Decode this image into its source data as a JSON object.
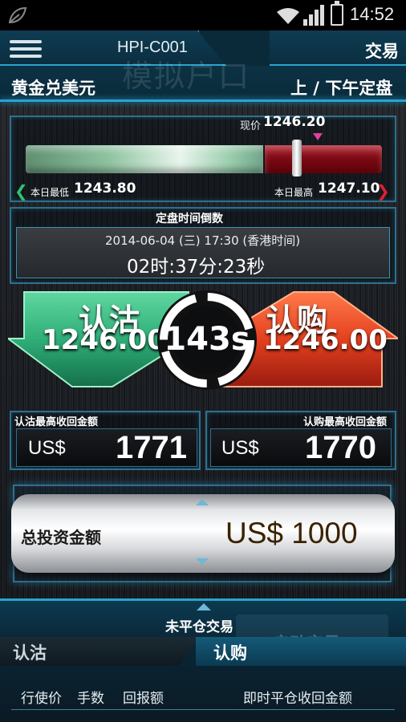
{
  "status_bar": {
    "time": "14:52",
    "icons": [
      "leaf-icon",
      "wifi-icon",
      "signal-icon",
      "battery-charging-icon"
    ]
  },
  "header": {
    "account": "HPI-C001",
    "trade_tab": "交易",
    "watermark": "模拟户口",
    "product": "黄金兑美元",
    "session": "上 / 下午定盘"
  },
  "price": {
    "now_label": "现价",
    "now_value": "1246.20",
    "low_label": "本日最低",
    "low_value": "1243.80",
    "high_label": "本日最高",
    "high_value": "1247.10",
    "now_position": 0.82
  },
  "countdown": {
    "title": "定盘时间倒数",
    "date_line": "2014-06-04 (三) 17:30 (香港时间)",
    "remaining": "02时:37分:23秒"
  },
  "trade": {
    "put_label": "认沽",
    "put_price": "1246.00",
    "call_label": "认购",
    "call_price": "1246.00",
    "dial": "143s",
    "colors": {
      "put": "#2fae78",
      "call": "#e4401f"
    }
  },
  "payout": {
    "put_title": "认沽最高收回金额",
    "put_currency": "US$",
    "put_value": "1771",
    "call_title": "认购最高收回金额",
    "call_currency": "US$",
    "call_value": "1770"
  },
  "investment": {
    "label": "总投资金额",
    "value": "US$ 1000"
  },
  "positions": {
    "title": "未平仓交易",
    "start_button": "启动交易",
    "tab_put": "认沽",
    "tab_call": "认购",
    "columns": [
      "行使价",
      "手数",
      "回报额",
      "即时平仓收回金额"
    ]
  }
}
